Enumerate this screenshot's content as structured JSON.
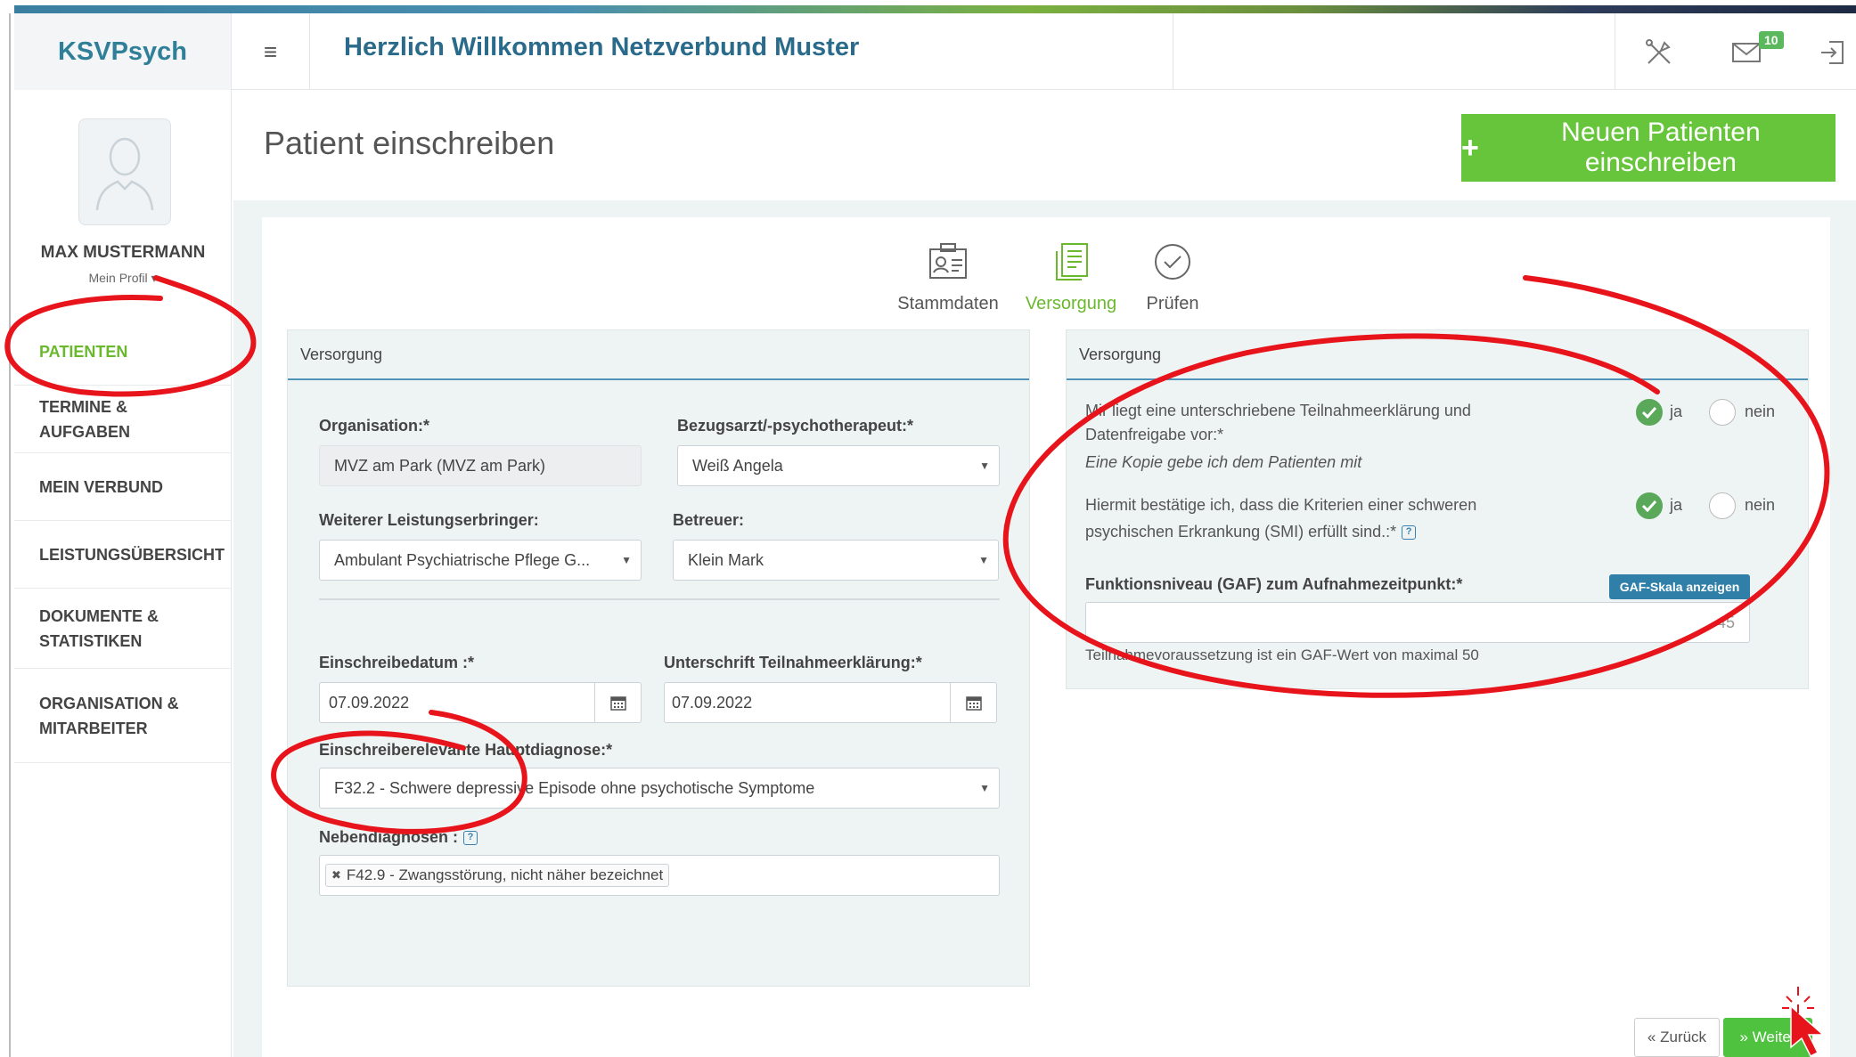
{
  "header": {
    "brand": "KSVPsych",
    "welcome": "Herzlich Willkommen Netzverbund Muster",
    "mail_count": "10"
  },
  "sidebar": {
    "username": "MAX MUSTERMANN",
    "profile_link": "Mein Profil",
    "items": [
      {
        "label": "PATIENTEN",
        "active": true
      },
      {
        "label": "TERMINE & AUFGABEN"
      },
      {
        "label": "MEIN VERBUND"
      },
      {
        "label": "LEISTUNGSÜBERSICHT"
      },
      {
        "label": "DOKUMENTE & STATISTIKEN"
      },
      {
        "label": "ORGANISATION & MITARBEITER"
      }
    ]
  },
  "page": {
    "title": "Patient einschreiben",
    "new_patient_button": "Neuen Patienten einschreiben"
  },
  "steps": [
    {
      "label": "Stammdaten"
    },
    {
      "label": "Versorgung",
      "active": true
    },
    {
      "label": "Prüfen"
    }
  ],
  "left_panel": {
    "title": "Versorgung",
    "organisation_label": "Organisation:*",
    "organisation_value": "MVZ am Park (MVZ am Park)",
    "bezugsarzt_label": "Bezugsarzt/-psychotherapeut:*",
    "bezugsarzt_value": "Weiß Angela",
    "leistungserbringer_label": "Weiterer Leistungserbringer:",
    "leistungserbringer_value": "Ambulant Psychiatrische Pflege G...",
    "betreuer_label": "Betreuer:",
    "betreuer_value": "Klein Mark",
    "einschreibedatum_label": "Einschreibedatum :*",
    "einschreibedatum_value": "07.09.2022",
    "unterschrift_label": "Unterschrift Teilnahmeerklärung:*",
    "unterschrift_value": "07.09.2022",
    "hauptdiagnose_label": "Einschreiberelevante Hauptdiagnose:*",
    "hauptdiagnose_value": "F32.2 - Schwere depressive Episode ohne psychotische Symptome",
    "nebendiagnosen_label": "Nebendiagnosen :",
    "nebendiagnosen_tag": "F42.9 - Zwangsstörung, nicht näher bezeichnet"
  },
  "right_panel": {
    "title": "Versorgung",
    "q1_line1": "Mir liegt eine unterschriebene Teilnahmeerklärung und",
    "q1_line2": "Datenfreigabe vor:*",
    "q1_note": "Eine Kopie gebe ich dem Patienten mit",
    "q2_line1": "Hiermit bestätige ich, dass die Kriterien einer schweren",
    "q2_line2": "psychischen Erkrankung (SMI) erfüllt sind.:*",
    "yes": "ja",
    "no": "nein",
    "gaf_label": "Funktionsniveau (GAF) zum Aufnahmezeitpunkt:*",
    "gaf_button": "GAF-Skala anzeigen",
    "gaf_value": "45",
    "gaf_hint": "Teilnahmevoraussetzung ist ein GAF-Wert von maximal 50"
  },
  "footer": {
    "back": "« Zurück",
    "next": "» Weiter"
  },
  "colors": {
    "brand": "#2f7f99",
    "accent_green": "#66c53a",
    "annotation_red": "#e8141b"
  }
}
